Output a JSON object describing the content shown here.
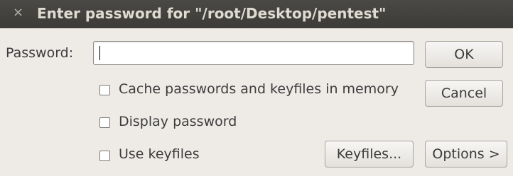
{
  "dialog": {
    "close_glyph": "×",
    "title": "Enter password for \"/root/Desktop/pentest\""
  },
  "password": {
    "label": "Password:",
    "value": ""
  },
  "options": {
    "cache_label": "Cache passwords and keyfiles in memory",
    "cache_checked": false,
    "display_label": "Display password",
    "display_checked": false,
    "keyfiles_label": "Use keyfiles",
    "keyfiles_checked": false
  },
  "buttons": {
    "ok": "OK",
    "cancel": "Cancel",
    "keyfiles": "Keyfiles...",
    "options": "Options >"
  },
  "colors": {
    "titlebar_bg": "#3c3b37",
    "window_bg": "#eeebe7"
  }
}
